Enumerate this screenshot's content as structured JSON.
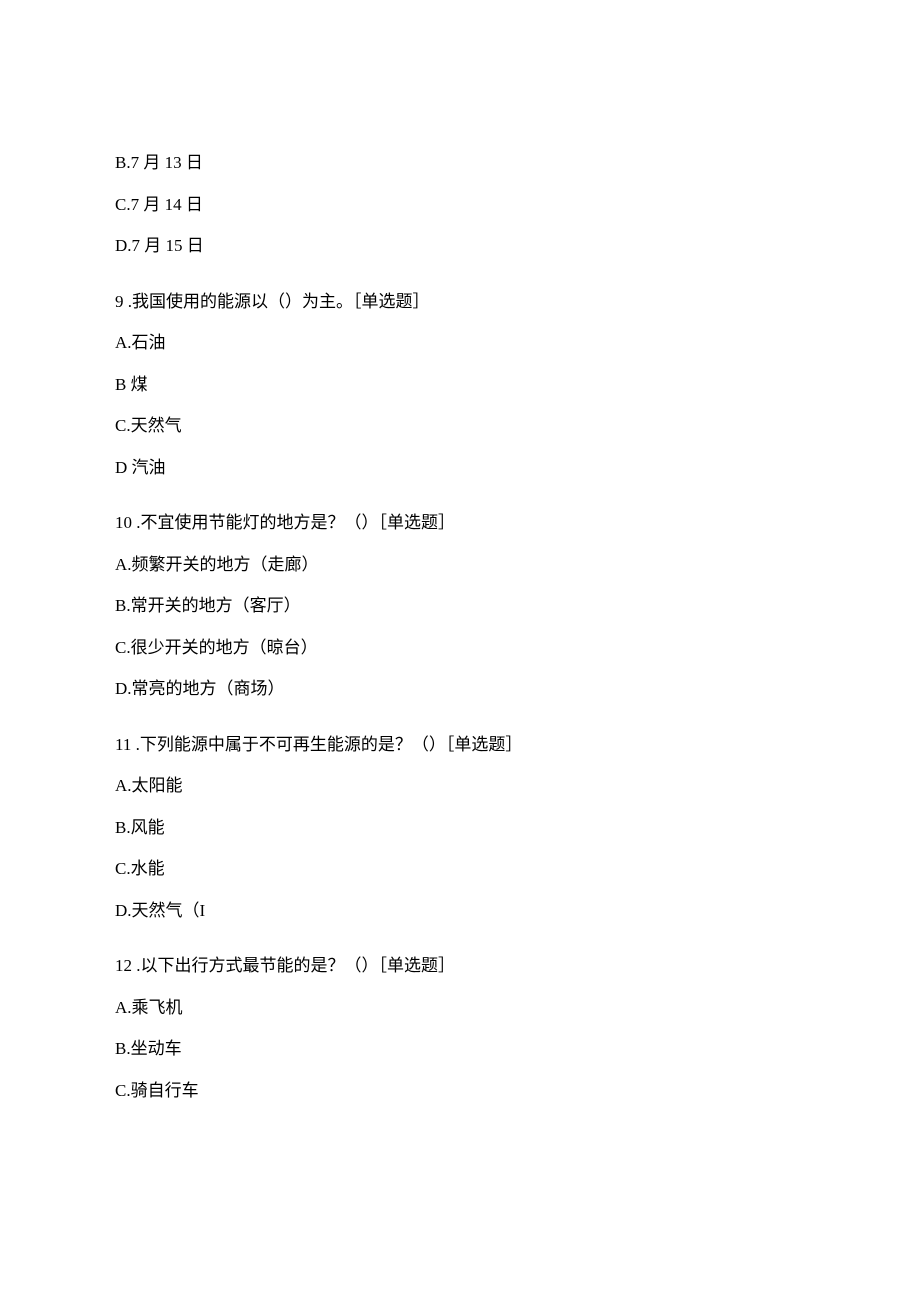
{
  "questions": [
    {
      "options_before": [
        {
          "label": "B.7 月 13 日"
        },
        {
          "label": "C.7 月 14 日"
        },
        {
          "label": "D.7 月 15 日"
        }
      ]
    },
    {
      "number": "9",
      "text": " .我国使用的能源以（）为主。［单选题］",
      "options": [
        {
          "label": "A.石油"
        },
        {
          "label": "B 煤"
        },
        {
          "label": "C.天然气"
        },
        {
          "label": "D 汽油"
        }
      ]
    },
    {
      "number": "10",
      "text": " .不宜使用节能灯的地方是？（）［单选题］",
      "options": [
        {
          "label": "A.频繁开关的地方（走廊）"
        },
        {
          "label": "B.常开关的地方（客厅）"
        },
        {
          "label": "C.很少开关的地方（晾台）"
        },
        {
          "label": "D.常亮的地方（商场）"
        }
      ]
    },
    {
      "number": "11",
      "text": " .下列能源中属于不可再生能源的是？（）［单选题］",
      "options": [
        {
          "label": "A.太阳能"
        },
        {
          "label": "B.风能"
        },
        {
          "label": "C.水能"
        },
        {
          "label": "D.天然气（I"
        }
      ]
    },
    {
      "number": "12",
      "text": " .以下出行方式最节能的是？（）［单选题］",
      "options": [
        {
          "label": "A.乘飞机"
        },
        {
          "label": "B.坐动车"
        },
        {
          "label": "C.骑自行车"
        }
      ]
    }
  ]
}
